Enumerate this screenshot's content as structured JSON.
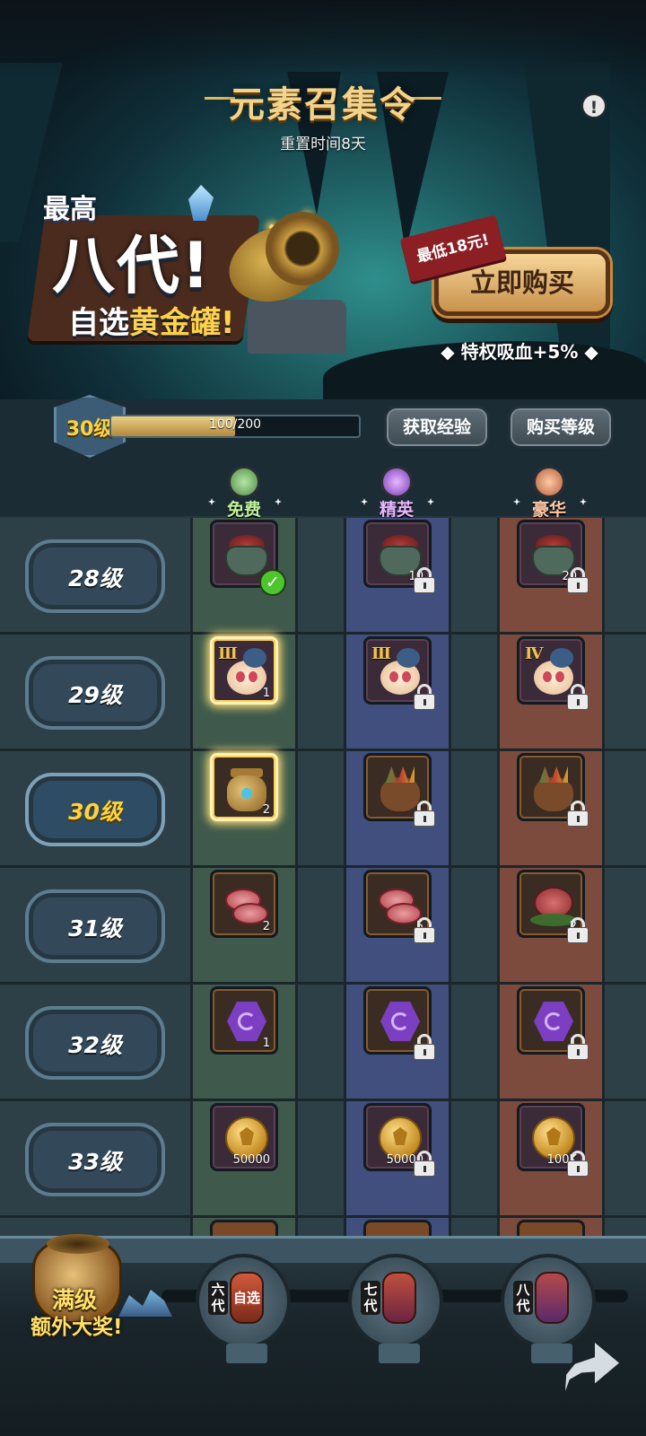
{
  "banner": {
    "title": "元素召集令",
    "reset_time": "重置时间8天",
    "info_icon": "exclamation-icon",
    "promo_top": "最高",
    "promo_main": "八代!",
    "promo_line_a": "自选",
    "promo_line_b": "黄金罐!",
    "min_price_tag": "最低18元!",
    "buy_button": "立即购买",
    "privilege": "特权吸血+5%"
  },
  "level": {
    "current": "30级",
    "progress_text": "100/200",
    "progress_fraction": 0.5,
    "get_exp_button": "获取经验",
    "buy_level_button": "购买等级"
  },
  "tiers": {
    "free": "免费",
    "elite": "精英",
    "luxury": "豪华"
  },
  "rows": [
    {
      "level": "28级",
      "current": false,
      "free": {
        "icon": "pot-icon",
        "qty": "",
        "claimed": true
      },
      "elite": {
        "icon": "pot-icon",
        "qty": "10",
        "locked": true
      },
      "luxury": {
        "icon": "pot-icon",
        "qty": "20",
        "locked": true
      }
    },
    {
      "level": "29级",
      "current": false,
      "free": {
        "icon": "egg-pet-icon",
        "qty": "1",
        "roman": "Ⅲ",
        "claimable": true
      },
      "elite": {
        "icon": "egg-pet-icon",
        "qty": "",
        "roman": "Ⅲ",
        "locked": true
      },
      "luxury": {
        "icon": "egg-pet-icon",
        "qty": "",
        "roman": "Ⅳ",
        "locked": true
      }
    },
    {
      "level": "30级",
      "current": true,
      "free": {
        "icon": "golden-jar-icon",
        "qty": "2",
        "claimable": true
      },
      "elite": {
        "icon": "treasure-bag-icon",
        "qty": "1",
        "locked": true
      },
      "luxury": {
        "icon": "treasure-bag-icon",
        "qty": "1",
        "locked": true
      }
    },
    {
      "level": "31级",
      "current": false,
      "free": {
        "icon": "meat-icon",
        "qty": "2"
      },
      "elite": {
        "icon": "meat-icon",
        "qty": "5",
        "locked": true
      },
      "luxury": {
        "icon": "roast-meat-icon",
        "qty": "2",
        "locked": true
      }
    },
    {
      "level": "32级",
      "current": false,
      "free": {
        "icon": "purple-hex-gem-icon",
        "qty": "1"
      },
      "elite": {
        "icon": "purple-hex-gem-icon",
        "qty": "1",
        "locked": true
      },
      "luxury": {
        "icon": "purple-hex-gem-icon",
        "qty": "1",
        "locked": true
      }
    },
    {
      "level": "33级",
      "current": false,
      "free": {
        "icon": "gold-coin-icon",
        "qty": "50000"
      },
      "elite": {
        "icon": "gold-coin-icon",
        "qty": "50000",
        "locked": true
      },
      "luxury": {
        "icon": "gold-coin-icon",
        "qty": "100K",
        "locked": true
      }
    }
  ],
  "footer": {
    "grand_line1": "满级",
    "grand_line2": "额外大奖!",
    "milestones": [
      {
        "gen": "六代",
        "sub": "自选"
      },
      {
        "gen": "七代",
        "sub": ""
      },
      {
        "gen": "八代",
        "sub": ""
      }
    ],
    "share_icon": "share-arrow-icon"
  },
  "colors": {
    "free_column": "#3f5a4c",
    "elite_column": "#404f7e",
    "luxury_column": "#7d4b3d",
    "level_highlight": "#ffd23d"
  }
}
